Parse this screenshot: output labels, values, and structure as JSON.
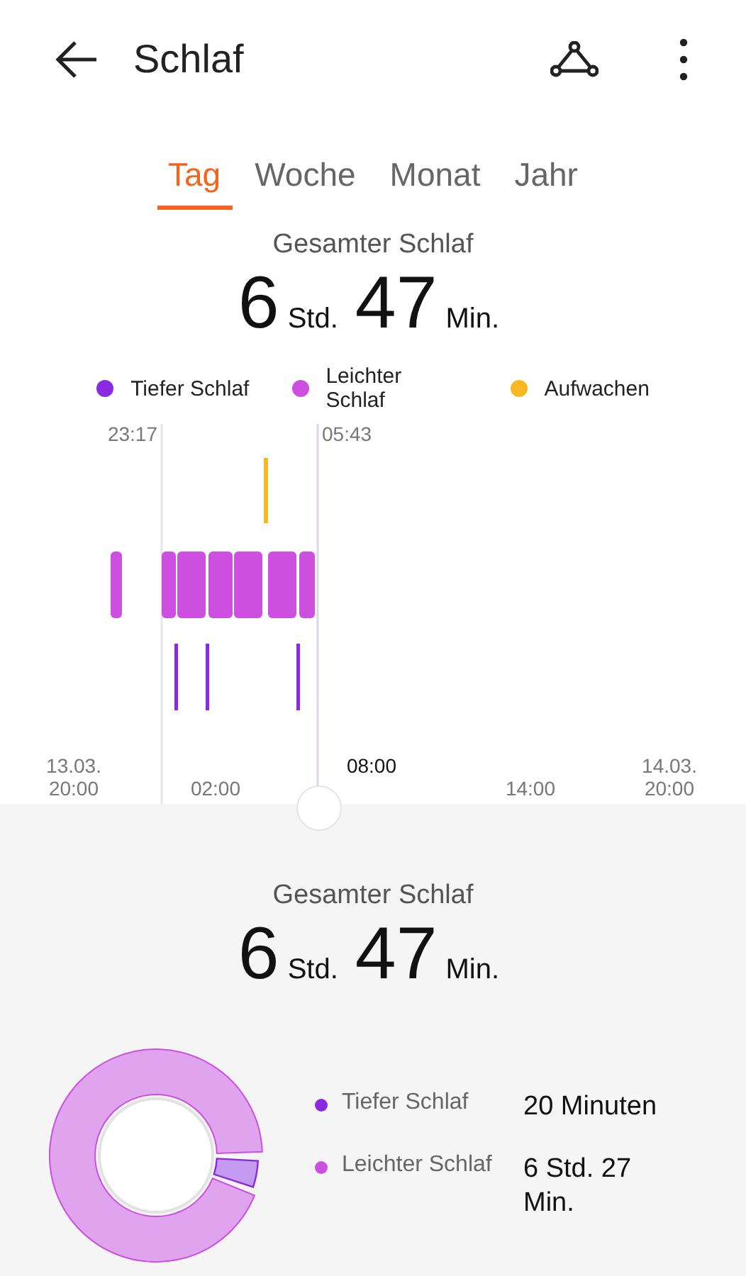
{
  "header": {
    "title": "Schlaf"
  },
  "tabs": [
    {
      "label": "Tag",
      "selected": true
    },
    {
      "label": "Woche",
      "selected": false
    },
    {
      "label": "Monat",
      "selected": false
    },
    {
      "label": "Jahr",
      "selected": false
    }
  ],
  "summary": {
    "label": "Gesamter Schlaf",
    "hours": "6",
    "hours_unit": "Std.",
    "minutes": "47",
    "minutes_unit": "Min."
  },
  "legend": [
    {
      "label": "Tiefer Schlaf",
      "color": "#8a2be2"
    },
    {
      "label": "Leichter Schlaf",
      "color": "#cc4fe0"
    },
    {
      "label": "Aufwachen",
      "color": "#f8b822"
    }
  ],
  "timeline": {
    "start": "23:17",
    "end": "05:43",
    "ticks": [
      {
        "line1": "13.03.",
        "line2": "20:00"
      },
      {
        "line2": "02:00"
      },
      {
        "line1": "08:00"
      },
      {
        "line2": "14:00"
      },
      {
        "line1": "14.03.",
        "line2": "20:00"
      }
    ]
  },
  "details": {
    "label": "Gesamter Schlaf",
    "hours": "6",
    "hours_unit": "Std.",
    "minutes": "47",
    "minutes_unit": "Min.",
    "items": [
      {
        "label": "Tiefer Schlaf",
        "value": "20 Minuten",
        "color": "#8a2be2"
      },
      {
        "label": "Leichter Schlaf",
        "value": "6 Std. 27 Min.",
        "color": "#cc4fe0"
      }
    ]
  }
}
